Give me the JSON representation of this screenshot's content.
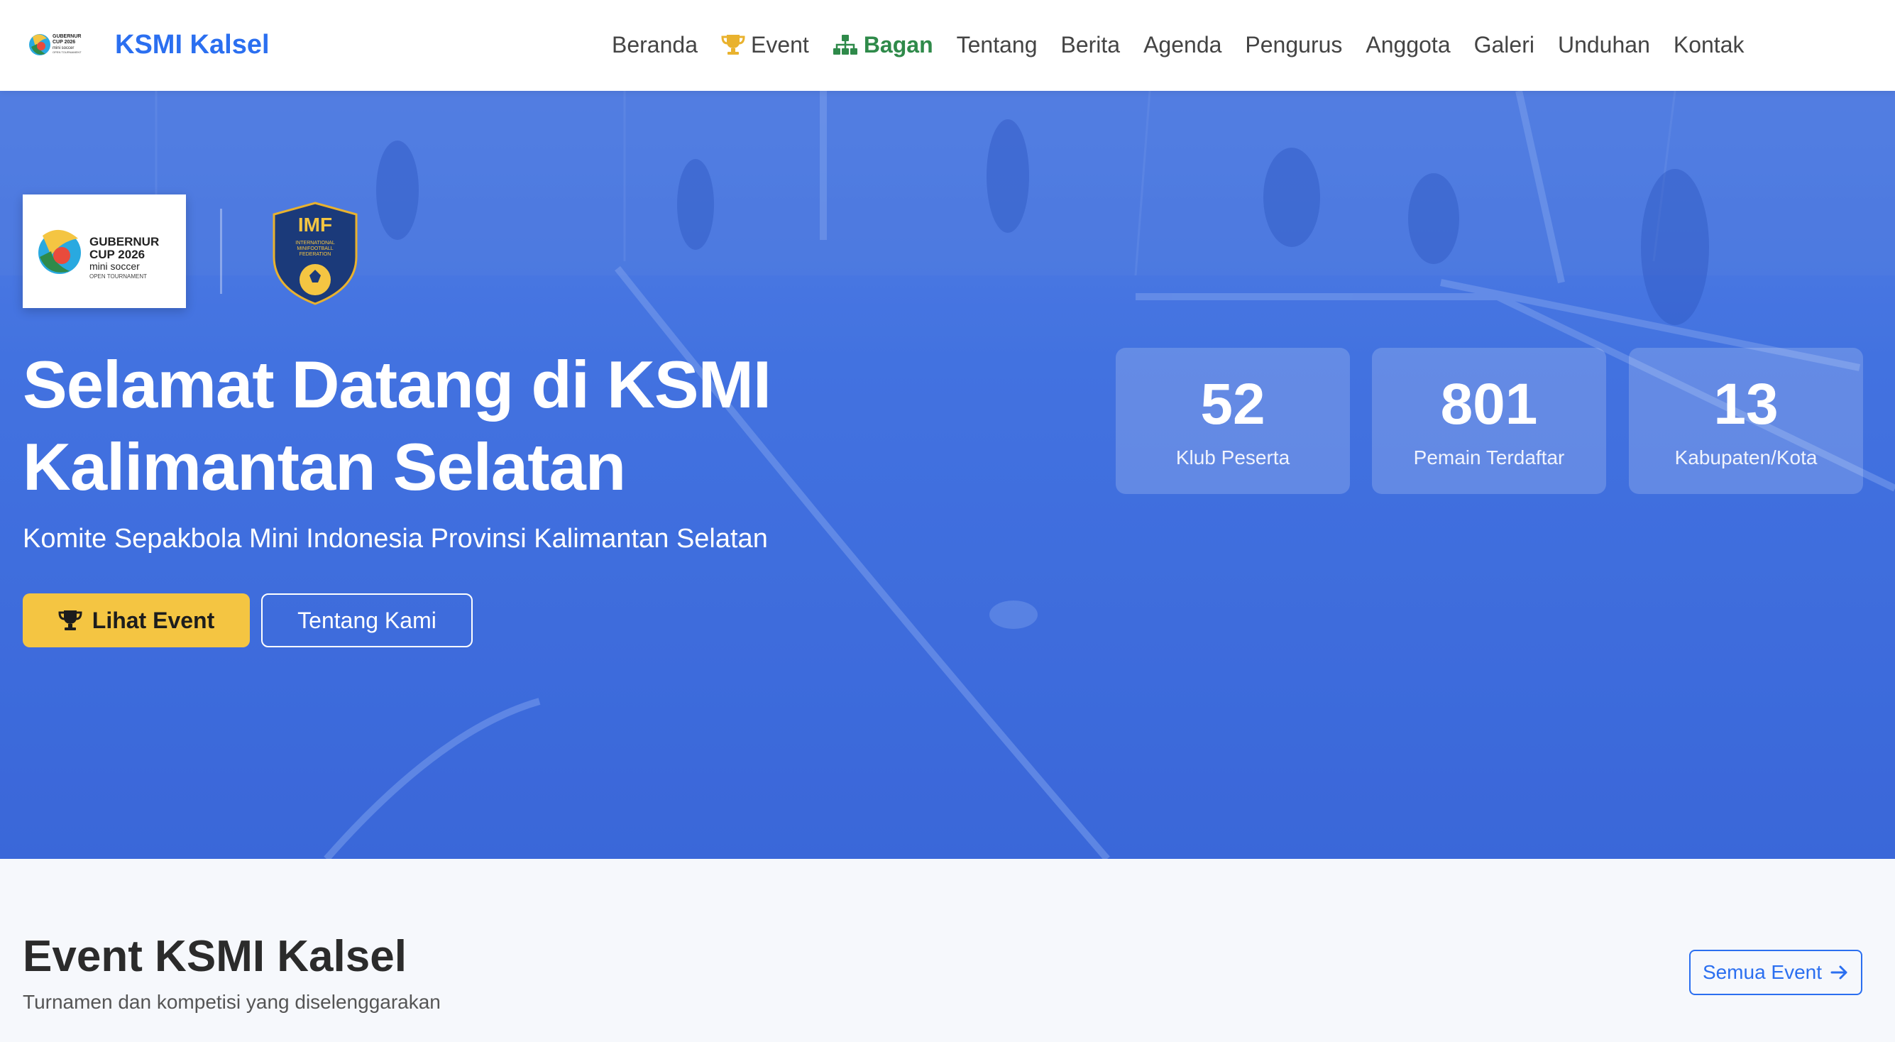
{
  "brand": {
    "name": "KSMI Kalsel",
    "logo_text": [
      "GUBERNUR",
      "CUP 2026",
      "mini soccer",
      "OPEN TOURNAMENT"
    ]
  },
  "nav": {
    "items": [
      {
        "label": "Beranda",
        "icon": null
      },
      {
        "label": "Event",
        "icon": "trophy-icon"
      },
      {
        "label": "Bagan",
        "icon": "sitemap-icon",
        "active": true
      },
      {
        "label": "Tentang",
        "icon": null
      },
      {
        "label": "Berita",
        "icon": null
      },
      {
        "label": "Agenda",
        "icon": null
      },
      {
        "label": "Pengurus",
        "icon": null
      },
      {
        "label": "Anggota",
        "icon": null
      },
      {
        "label": "Galeri",
        "icon": null
      },
      {
        "label": "Unduhan",
        "icon": null
      },
      {
        "label": "Kontak",
        "icon": null
      }
    ]
  },
  "hero": {
    "logos": {
      "gubernur": [
        "GUBERNUR",
        "CUP 2026",
        "mini soccer",
        "OPEN TOURNAMENT"
      ],
      "imf": [
        "IMF",
        "INTERNATIONAL",
        "MINIFOOTBALL",
        "FEDERATION"
      ]
    },
    "title": "Selamat Datang di KSMI Kalimantan Selatan",
    "subtitle": "Komite Sepakbola Mini Indonesia Provinsi Kalimantan Selatan",
    "primary_button": "Lihat Event",
    "secondary_button": "Tentang Kami",
    "stats": [
      {
        "value": "52",
        "label": "Klub Peserta"
      },
      {
        "value": "801",
        "label": "Pemain Terdaftar"
      },
      {
        "value": "13",
        "label": "Kabupaten/Kota"
      }
    ]
  },
  "events": {
    "title": "Event KSMI Kalsel",
    "subtitle": "Turnamen dan kompetisi yang diselenggarakan",
    "all_button": "Semua Event"
  },
  "colors": {
    "brand_blue": "#2b6ff0",
    "active_green": "#2f8a4a",
    "hero_blue": "#3f6fe0",
    "button_yellow": "#f4c542",
    "trophy_gold": "#e9b22e"
  }
}
